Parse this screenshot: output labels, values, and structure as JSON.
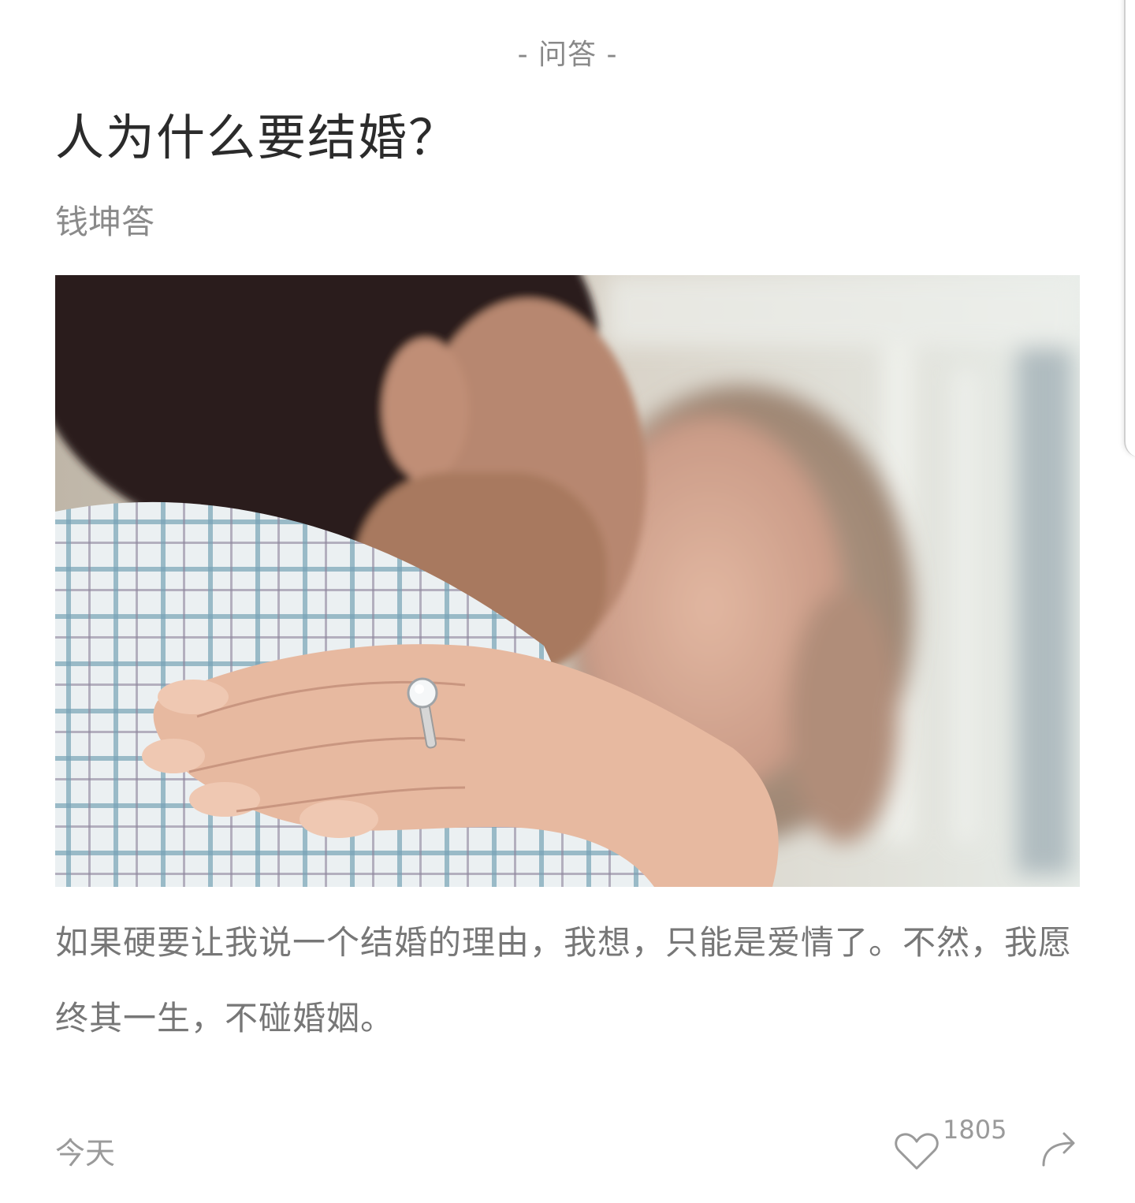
{
  "header": {
    "category": "- 问答 -"
  },
  "article": {
    "title": "人为什么要结婚？",
    "author": "钱坤答",
    "image_desc_icon": "photo-couple-embrace",
    "body": "如果硬要让我说一个结婚的理由，我想，只能是爱情了。不然，我愿终其一生，不碰婚姻。"
  },
  "footer": {
    "date": "今天",
    "like_count": "1805",
    "like_icon": "heart-icon",
    "share_icon": "share-icon"
  },
  "colors": {
    "text_primary": "#2b2b2b",
    "text_secondary": "#8a8a8a",
    "text_body": "#777777"
  }
}
